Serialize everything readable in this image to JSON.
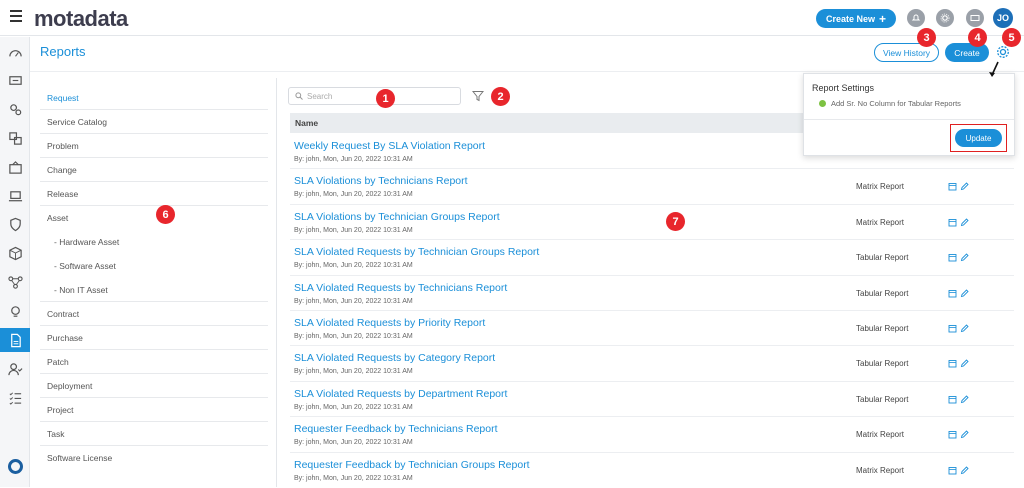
{
  "app": {
    "logo": "motadata",
    "create_new": "Create New",
    "avatar": "JO"
  },
  "page": {
    "title": "Reports",
    "view_history": "View History",
    "create": "Create"
  },
  "search": {
    "placeholder": "Search"
  },
  "table": {
    "name_header": "Name"
  },
  "categories": [
    {
      "label": "Request",
      "active": true
    },
    {
      "label": "Service Catalog"
    },
    {
      "label": "Problem"
    },
    {
      "label": "Change"
    },
    {
      "label": "Release"
    },
    {
      "label": "Asset"
    },
    {
      "label": "- Hardware Asset"
    },
    {
      "label": "- Software Asset"
    },
    {
      "label": "- Non IT Asset"
    },
    {
      "label": "Contract"
    },
    {
      "label": "Purchase"
    },
    {
      "label": "Patch"
    },
    {
      "label": "Deployment"
    },
    {
      "label": "Project"
    },
    {
      "label": "Task"
    },
    {
      "label": "Software License"
    }
  ],
  "reports": [
    {
      "name": "Weekly Request By SLA Violation Report",
      "meta": "By: john, Mon, Jun 20, 2022 10:31 AM",
      "type": ""
    },
    {
      "name": "SLA Violations by Technicians Report",
      "meta": "By: john, Mon, Jun 20, 2022 10:31 AM",
      "type": "Matrix Report"
    },
    {
      "name": "SLA Violations by Technician Groups Report",
      "meta": "By: john, Mon, Jun 20, 2022 10:31 AM",
      "type": "Matrix Report"
    },
    {
      "name": "SLA Violated Requests by Technician Groups Report",
      "meta": "By: john, Mon, Jun 20, 2022 10:31 AM",
      "type": "Tabular Report"
    },
    {
      "name": "SLA Violated Requests by Technicians Report",
      "meta": "By: john, Mon, Jun 20, 2022 10:31 AM",
      "type": "Tabular Report"
    },
    {
      "name": "SLA Violated Requests by Priority Report",
      "meta": "By: john, Mon, Jun 20, 2022 10:31 AM",
      "type": "Tabular Report"
    },
    {
      "name": "SLA Violated Requests by Category Report",
      "meta": "By: john, Mon, Jun 20, 2022 10:31 AM",
      "type": "Tabular Report"
    },
    {
      "name": "SLA Violated Requests by Department Report",
      "meta": "By: john, Mon, Jun 20, 2022 10:31 AM",
      "type": "Tabular Report"
    },
    {
      "name": "Requester Feedback by Technicians Report",
      "meta": "By: john, Mon, Jun 20, 2022 10:31 AM",
      "type": "Matrix Report"
    },
    {
      "name": "Requester Feedback by Technician Groups Report",
      "meta": "By: john, Mon, Jun 20, 2022 10:31 AM",
      "type": "Matrix Report"
    }
  ],
  "popover": {
    "title": "Report Settings",
    "option": "Add Sr. No Column for Tabular Reports",
    "update": "Update"
  },
  "markers": [
    "1",
    "2",
    "3",
    "4",
    "5",
    "6",
    "7"
  ],
  "colors": {
    "accent": "#1b8fd8",
    "marker": "#e8262c"
  }
}
